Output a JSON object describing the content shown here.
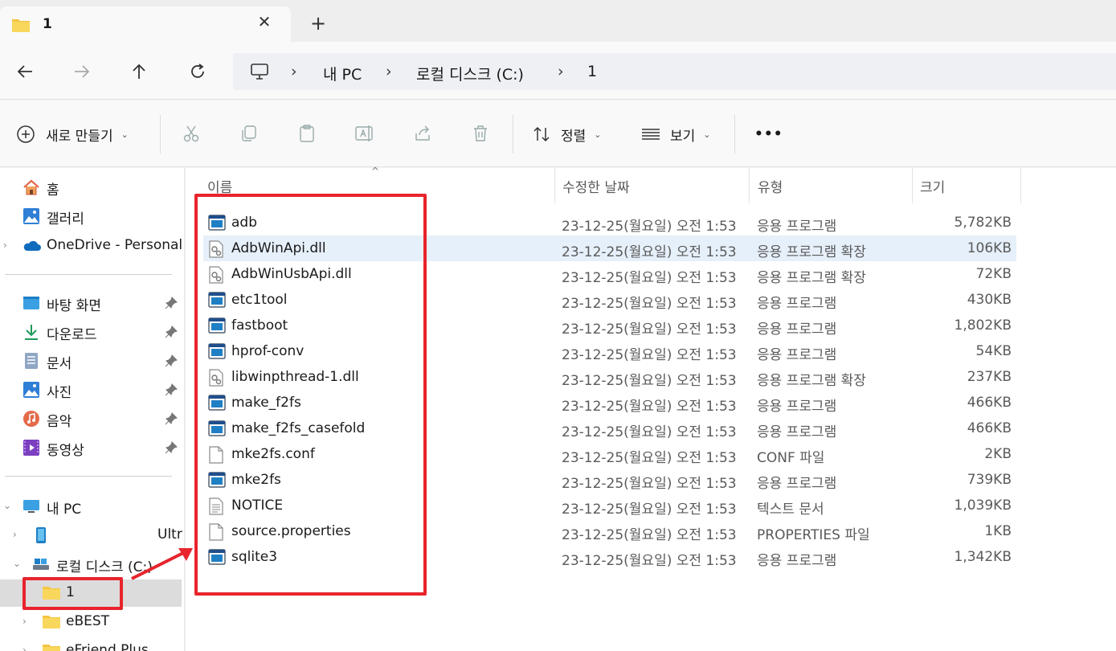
{
  "window": {
    "tab_title": "1",
    "close_glyph": "✕",
    "new_tab_glyph": "+"
  },
  "nav": {
    "breadcrumb": [
      "내 PC",
      "로컬 디스크 (C:)",
      "1"
    ],
    "separator": "›"
  },
  "commands": {
    "new_label": "새로 만들기",
    "sort_label": "정렬",
    "view_label": "보기",
    "more_label": "•••",
    "caret": "⌄"
  },
  "sidebar": {
    "quick": [
      {
        "label": "홈",
        "icon": "home-icon"
      },
      {
        "label": "갤러리",
        "icon": "gallery-icon"
      },
      {
        "label": "OneDrive - Personal",
        "icon": "cloud-icon"
      }
    ],
    "pinned": [
      {
        "label": "바탕 화면",
        "icon": "desktop-icon"
      },
      {
        "label": "다운로드",
        "icon": "download-icon"
      },
      {
        "label": "문서",
        "icon": "document-icon"
      },
      {
        "label": "사진",
        "icon": "pictures-icon"
      },
      {
        "label": "음악",
        "icon": "music-icon"
      },
      {
        "label": "동영상",
        "icon": "video-icon"
      }
    ],
    "tree": [
      {
        "label": "내 PC",
        "icon": "pc-icon"
      },
      {
        "label": "Ultr",
        "icon": "phone-icon"
      },
      {
        "label": "로컬 디스크 (C:)",
        "icon": "drive-icon"
      },
      {
        "label": "1",
        "icon": "folder-icon"
      },
      {
        "label": "eBEST",
        "icon": "folder-icon"
      },
      {
        "label": "eFriend Plus",
        "icon": "folder-icon"
      }
    ]
  },
  "columns": {
    "name": "이름",
    "date": "수정한 날짜",
    "type": "유형",
    "size": "크기"
  },
  "files": [
    {
      "name": "adb",
      "date": "23-12-25(월요일) 오전 1:53",
      "type": "응용 프로그램",
      "size": "5,782KB",
      "kind": "exe"
    },
    {
      "name": "AdbWinApi.dll",
      "date": "23-12-25(월요일) 오전 1:53",
      "type": "응용 프로그램 확장",
      "size": "106KB",
      "kind": "dll"
    },
    {
      "name": "AdbWinUsbApi.dll",
      "date": "23-12-25(월요일) 오전 1:53",
      "type": "응용 프로그램 확장",
      "size": "72KB",
      "kind": "dll"
    },
    {
      "name": "etc1tool",
      "date": "23-12-25(월요일) 오전 1:53",
      "type": "응용 프로그램",
      "size": "430KB",
      "kind": "exe"
    },
    {
      "name": "fastboot",
      "date": "23-12-25(월요일) 오전 1:53",
      "type": "응용 프로그램",
      "size": "1,802KB",
      "kind": "exe"
    },
    {
      "name": "hprof-conv",
      "date": "23-12-25(월요일) 오전 1:53",
      "type": "응용 프로그램",
      "size": "54KB",
      "kind": "exe"
    },
    {
      "name": "libwinpthread-1.dll",
      "date": "23-12-25(월요일) 오전 1:53",
      "type": "응용 프로그램 확장",
      "size": "237KB",
      "kind": "dll"
    },
    {
      "name": "make_f2fs",
      "date": "23-12-25(월요일) 오전 1:53",
      "type": "응용 프로그램",
      "size": "466KB",
      "kind": "exe"
    },
    {
      "name": "make_f2fs_casefold",
      "date": "23-12-25(월요일) 오전 1:53",
      "type": "응용 프로그램",
      "size": "466KB",
      "kind": "exe"
    },
    {
      "name": "mke2fs.conf",
      "date": "23-12-25(월요일) 오전 1:53",
      "type": "CONF 파일",
      "size": "2KB",
      "kind": "file"
    },
    {
      "name": "mke2fs",
      "date": "23-12-25(월요일) 오전 1:53",
      "type": "응용 프로그램",
      "size": "739KB",
      "kind": "exe"
    },
    {
      "name": "NOTICE",
      "date": "23-12-25(월요일) 오전 1:53",
      "type": "텍스트 문서",
      "size": "1,039KB",
      "kind": "text"
    },
    {
      "name": "source.properties",
      "date": "23-12-25(월요일) 오전 1:53",
      "type": "PROPERTIES 파일",
      "size": "1KB",
      "kind": "file"
    },
    {
      "name": "sqlite3",
      "date": "23-12-25(월요일) 오전 1:53",
      "type": "응용 프로그램",
      "size": "1,342KB",
      "kind": "exe"
    }
  ],
  "highlighted_row": 1,
  "colors": {
    "accent": "#0078d4",
    "annotation_red": "#e8242c",
    "folder_yellow": "#f4c542"
  }
}
